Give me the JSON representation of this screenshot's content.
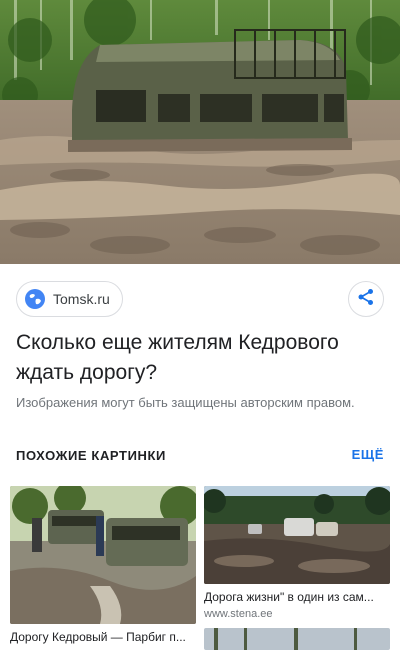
{
  "source": {
    "name": "Tomsk.ru",
    "icon": "globe-icon",
    "icon_color": "#4285f4"
  },
  "share": {
    "icon": "share-icon",
    "color": "#1a73e8"
  },
  "article": {
    "title": "Сколько еще жителям Кедрового ждать дорогу?",
    "copyright_note": "Изображения могут быть защищены авторским правом."
  },
  "related": {
    "header": "ПОХОЖИЕ КАРТИНКИ",
    "more_label": "ЕЩЁ",
    "items": [
      {
        "caption": "Дорогу Кедровый — Парбиг п...",
        "domain": ""
      },
      {
        "caption": "Дорога жизни\" в один из сам...",
        "domain": "www.stena.ee"
      }
    ]
  },
  "colors": {
    "accent": "#1a73e8",
    "text_primary": "#202124",
    "text_secondary": "#70757a",
    "border": "#dadce0"
  }
}
